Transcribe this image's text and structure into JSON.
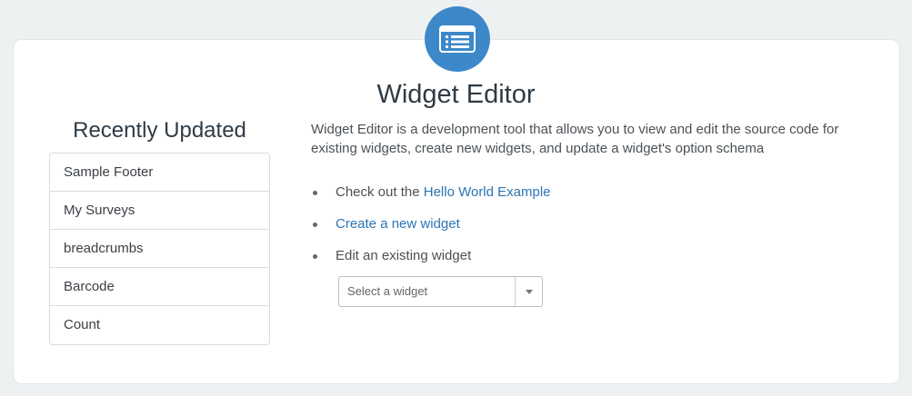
{
  "header": {
    "icon": "list-icon",
    "title": "Widget Editor"
  },
  "sidebar": {
    "title": "Recently Updated",
    "items": [
      "Sample Footer",
      "My Surveys",
      "breadcrumbs",
      "Barcode",
      "Count"
    ]
  },
  "main": {
    "description": "Widget Editor is a development tool that allows you to view and edit the source code for existing widgets, create new widgets, and update a widget's option schema",
    "check_out_prefix": "Check out the",
    "hello_world_link": "Hello World Example",
    "create_link": "Create a new widget",
    "edit_label": "Edit an existing widget",
    "select_placeholder": "Select a widget"
  },
  "colors": {
    "accent": "#3d88c9",
    "link": "#2b74b5",
    "background": "#eef1f2"
  }
}
